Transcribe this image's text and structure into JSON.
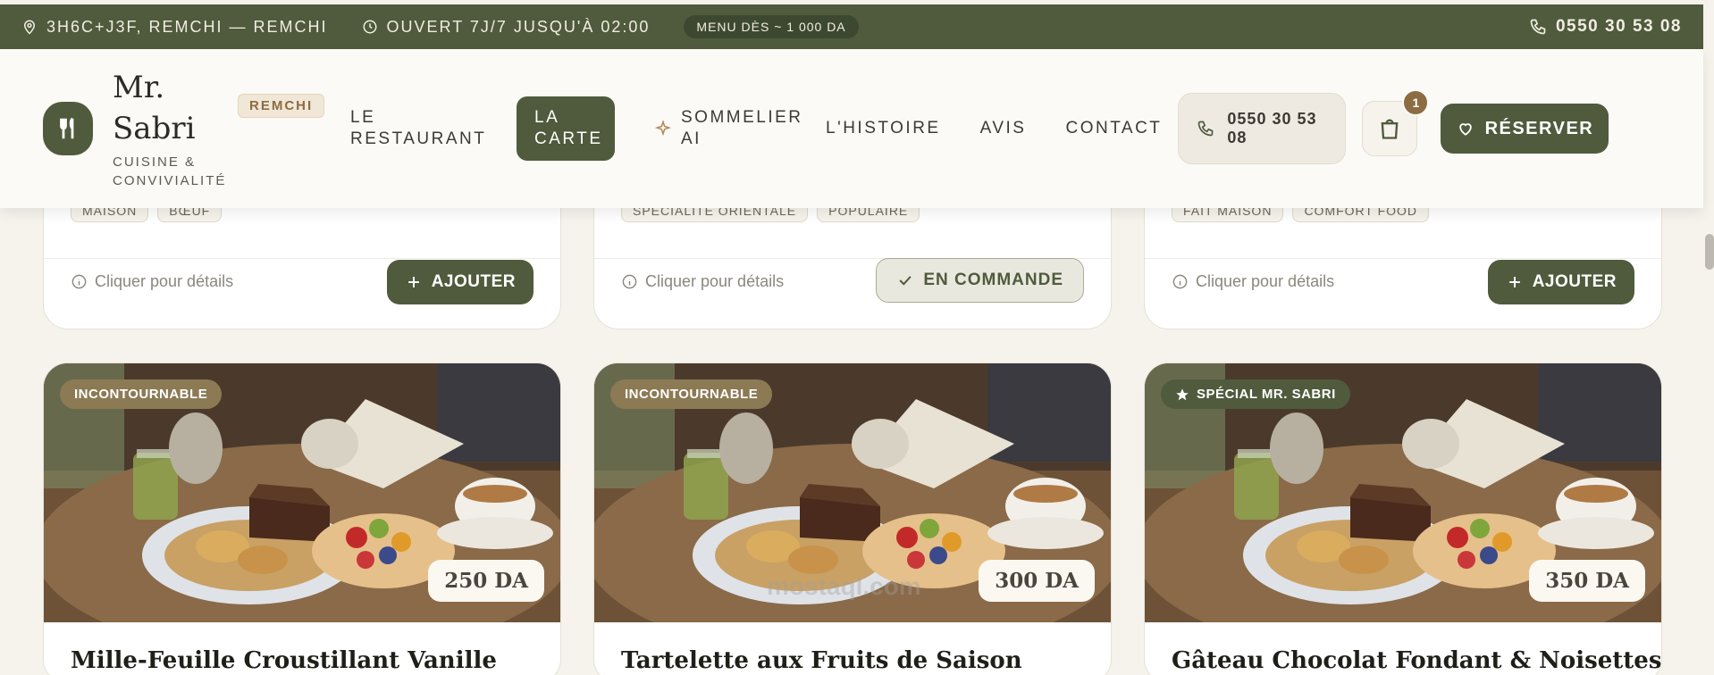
{
  "topbar": {
    "address": "3H6C+J3F, REMCHI — REMCHI",
    "hours": "OUVERT 7J/7 JUSQU'À 02:00",
    "menu_badge": "MENU DÈS ~ 1 000 DA",
    "phone": "0550 30 53 08"
  },
  "header": {
    "logo_name": "Mr. Sabri",
    "logo_sub": "CUISINE & CONVIVIALITÉ",
    "logo_tag": "REMCHI",
    "nav": [
      "LE RESTAURANT",
      "LA CARTE",
      "SOMMELIER AI",
      "L'HISTOIRE",
      "AVIS",
      "CONTACT"
    ],
    "phone": "0550 30 53 08",
    "cart_count": "1",
    "reserve_label": "RÉSERVER"
  },
  "row1": [
    {
      "tags": [
        "MAISON",
        "BŒUF"
      ],
      "details": "Cliquer pour détails",
      "action": "AJOUTER",
      "state": "add"
    },
    {
      "tags": [
        "SPÉCIALITÉ ORIENTALE",
        "POPULAIRE"
      ],
      "details": "Cliquer pour détails",
      "action": "EN COMMANDE",
      "state": "ordered"
    },
    {
      "tags": [
        "FAIT MAISON",
        "COMFORT FOOD"
      ],
      "details": "Cliquer pour détails",
      "action": "AJOUTER",
      "state": "add"
    }
  ],
  "row2": [
    {
      "badge": "INCONTOURNABLE",
      "price": "250 DA",
      "title": "Mille-Feuille Croustillant Vanille"
    },
    {
      "badge": "INCONTOURNABLE",
      "price": "300 DA",
      "title": "Tartelette aux Fruits de Saison"
    },
    {
      "badge": "SPÉCIAL MR. SABRI",
      "price": "350 DA",
      "title": "Gâteau Chocolat Fondant & Noisettes"
    }
  ],
  "watermark": "mostaql.com",
  "colors": {
    "primary": "#4f5b3c",
    "accent": "#8c6c43",
    "background": "#f6f3ec"
  }
}
